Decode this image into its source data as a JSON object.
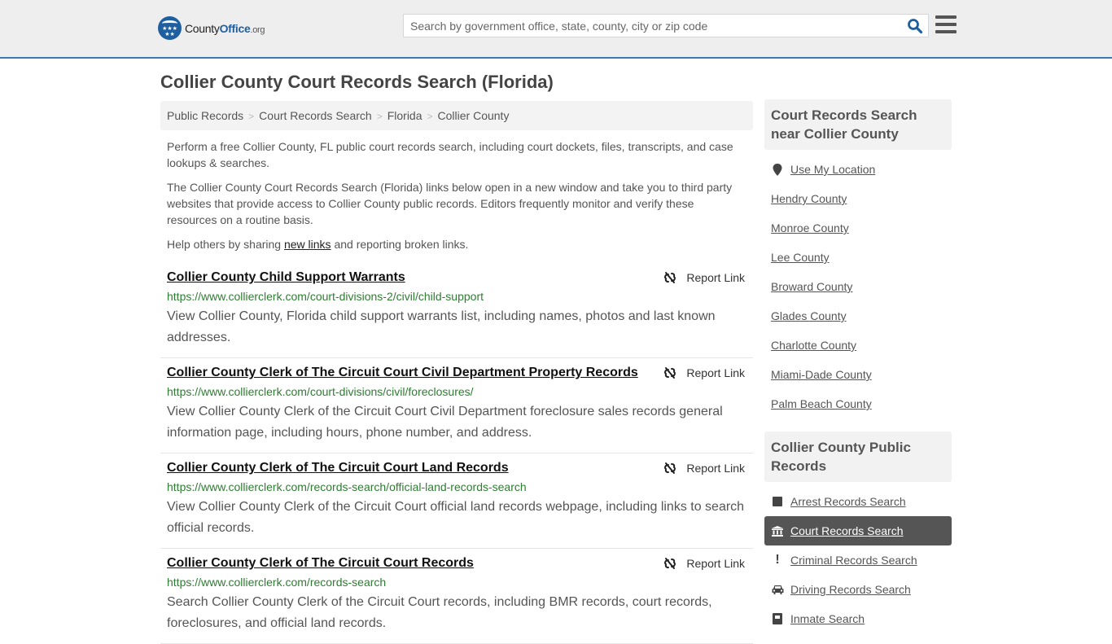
{
  "header": {
    "logo": {
      "prefix": "County",
      "brand": "Office",
      "tld": ".org"
    },
    "search": {
      "placeholder": "Search by government office, state, county, city or zip code",
      "value": ""
    },
    "search_icon": "search-icon",
    "menu_icon": "hamburger-menu-icon"
  },
  "page": {
    "title": "Collier County Court Records Search (Florida)"
  },
  "breadcrumb": [
    {
      "label": "Public Records"
    },
    {
      "label": "Court Records Search"
    },
    {
      "label": "Florida"
    },
    {
      "label": "Collier County"
    }
  ],
  "breadcrumb_separator": ">",
  "intro": {
    "p1": "Perform a free Collier County, FL public court records search, including court dockets, files, transcripts, and case lookups & searches.",
    "p2": "The Collier County Court Records Search (Florida) links below open in a new window and take you to third party websites that provide access to Collier County public records. Editors frequently monitor and verify these resources on a routine basis.",
    "p3_before": "Help others by sharing ",
    "p3_link": "new links",
    "p3_after": " and reporting broken links."
  },
  "results": [
    {
      "title": "Collier County Child Support Warrants",
      "url": "https://www.collierclerk.com/court-divisions-2/civil/child-support",
      "description": "View Collier County, Florida child support warrants list, including names, photos and last known addresses.",
      "report_label": "Report Link"
    },
    {
      "title": "Collier County Clerk of The Circuit Court Civil Department Property Records",
      "url": "https://www.collierclerk.com/court-divisions/civil/foreclosures/",
      "description": "View Collier County Clerk of the Circuit Court Civil Department foreclosure sales records general information page, including hours, phone number, and address.",
      "report_label": "Report Link"
    },
    {
      "title": "Collier County Clerk of The Circuit Court Land Records",
      "url": "https://www.collierclerk.com/records-search/official-land-records-search",
      "description": "View Collier County Clerk of the Circuit Court official land records webpage, including links to search official records.",
      "report_label": "Report Link"
    },
    {
      "title": "Collier County Clerk of The Circuit Court Records",
      "url": "https://www.collierclerk.com/records-search",
      "description": "Search Collier County Clerk of the Circuit Court records, including BMR records, court records, foreclosures, and official land records.",
      "report_label": "Report Link"
    }
  ],
  "sidebar": {
    "nearby": {
      "heading": "Court Records Search near Collier County",
      "location_label": "Use My Location",
      "counties": [
        "Hendry County",
        "Monroe County",
        "Lee County",
        "Broward County",
        "Glades County",
        "Charlotte County",
        "Miami-Dade County",
        "Palm Beach County"
      ]
    },
    "public_records": {
      "heading": "Collier County Public Records",
      "items": [
        {
          "label": "Arrest Records Search",
          "icon": "square-icon",
          "active": false
        },
        {
          "label": "Court Records Search",
          "icon": "courthouse-icon",
          "active": true
        },
        {
          "label": "Criminal Records Search",
          "icon": "exclamation-icon",
          "active": false
        },
        {
          "label": "Driving Records Search",
          "icon": "car-icon",
          "active": false
        },
        {
          "label": "Inmate Search",
          "icon": "jail-icon",
          "active": false
        }
      ]
    }
  },
  "colors": {
    "brand_blue": "#1f5fa0",
    "header_border": "#3a7ab4",
    "url_green": "#2e7d32",
    "active_item_bg": "#555555"
  }
}
